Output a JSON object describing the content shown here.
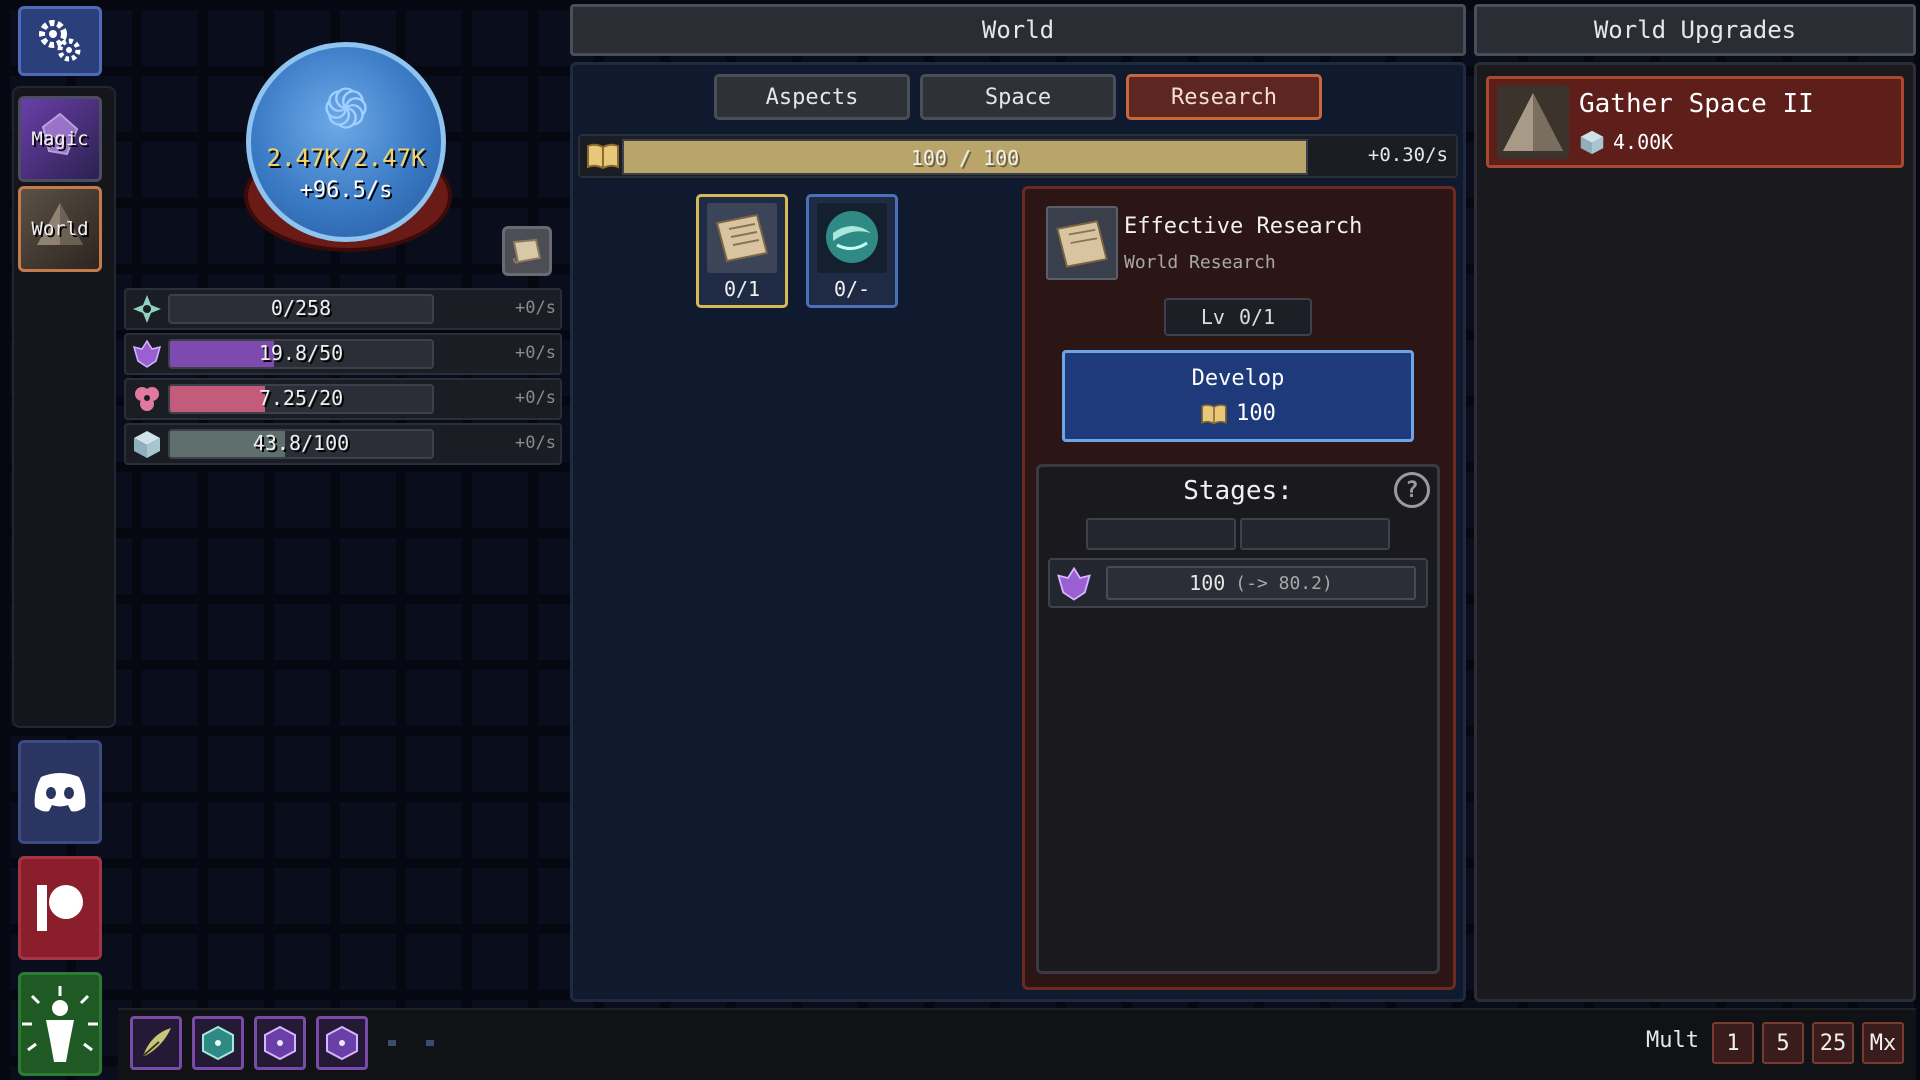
{
  "sidebar": {
    "settings_icon": "gears-icon",
    "tabs": [
      {
        "label": "Magic",
        "icon": "crystal-icon"
      },
      {
        "label": "World",
        "icon": "pyramid-icon"
      }
    ],
    "links": [
      {
        "name": "Discord",
        "icon": "discord-icon"
      },
      {
        "name": "Patreon",
        "icon": "patreon-icon"
      },
      {
        "name": "Character",
        "icon": "person-icon"
      }
    ]
  },
  "mana_orb": {
    "amount": "2.47K/2.47K",
    "rate": "+96.5/s",
    "fill_fraction": 1.0,
    "color": "#3a7ac4"
  },
  "resources": [
    {
      "icon": "space-star-icon",
      "value": "0",
      "max": "258",
      "rate": "+0/s",
      "fill": 0.0,
      "color": "#4a8a7a"
    },
    {
      "icon": "purple-crest-icon",
      "value": "19.8",
      "max": "50",
      "rate": "+0/s",
      "fill": 0.396,
      "color": "#7d4bb0"
    },
    {
      "icon": "heart-triad-icon",
      "value": "7.25",
      "max": "20",
      "rate": "+0/s",
      "fill": 0.3625,
      "color": "#c25c7a"
    },
    {
      "icon": "cube-icon",
      "value": "43.8",
      "max": "100",
      "rate": "+0/s",
      "fill": 0.438,
      "color": "#5f6f6e"
    }
  ],
  "world": {
    "title": "World",
    "tabs": [
      {
        "label": "Aspects",
        "active": false
      },
      {
        "label": "Space",
        "active": false
      },
      {
        "label": "Research",
        "active": true
      }
    ],
    "research_bar": {
      "icon": "book-icon",
      "text": "100 / 100",
      "fill": 1.0,
      "rate": "+0.30/s",
      "color": "#b9a46a"
    },
    "research_cards": [
      {
        "icon": "research-book-icon",
        "count": "0/1",
        "selected": true
      },
      {
        "icon": "teal-orb-icon",
        "count": "0/-",
        "selected": false
      }
    ]
  },
  "detail": {
    "title": "Effective Research",
    "subtitle": "World Research",
    "level_label": "Lv",
    "level_value": "0/1",
    "develop_label": "Develop",
    "develop_cost": "100",
    "develop_cost_icon": "book-icon",
    "stages_title": "Stages:",
    "help_icon": "question-icon",
    "stage_rows": [
      {
        "icon": "purple-crest-icon",
        "value": "100",
        "preview": "(-> 80.2)"
      }
    ]
  },
  "world_upgrades": {
    "title": "World Upgrades",
    "items": [
      {
        "name": "Gather Space II",
        "cost": "4.00K",
        "cost_icon": "cube-icon",
        "icon": "pyramid-icon"
      }
    ]
  },
  "bottom_bar": {
    "slots": [
      {
        "icon": "feather-quill-icon"
      },
      {
        "icon": "teal-dice-icon"
      },
      {
        "icon": "purple-dice-icon"
      },
      {
        "icon": "purple-dice-icon"
      }
    ],
    "mult_label": "Mult",
    "mult_options": [
      "1",
      "5",
      "25",
      "Mx"
    ]
  }
}
